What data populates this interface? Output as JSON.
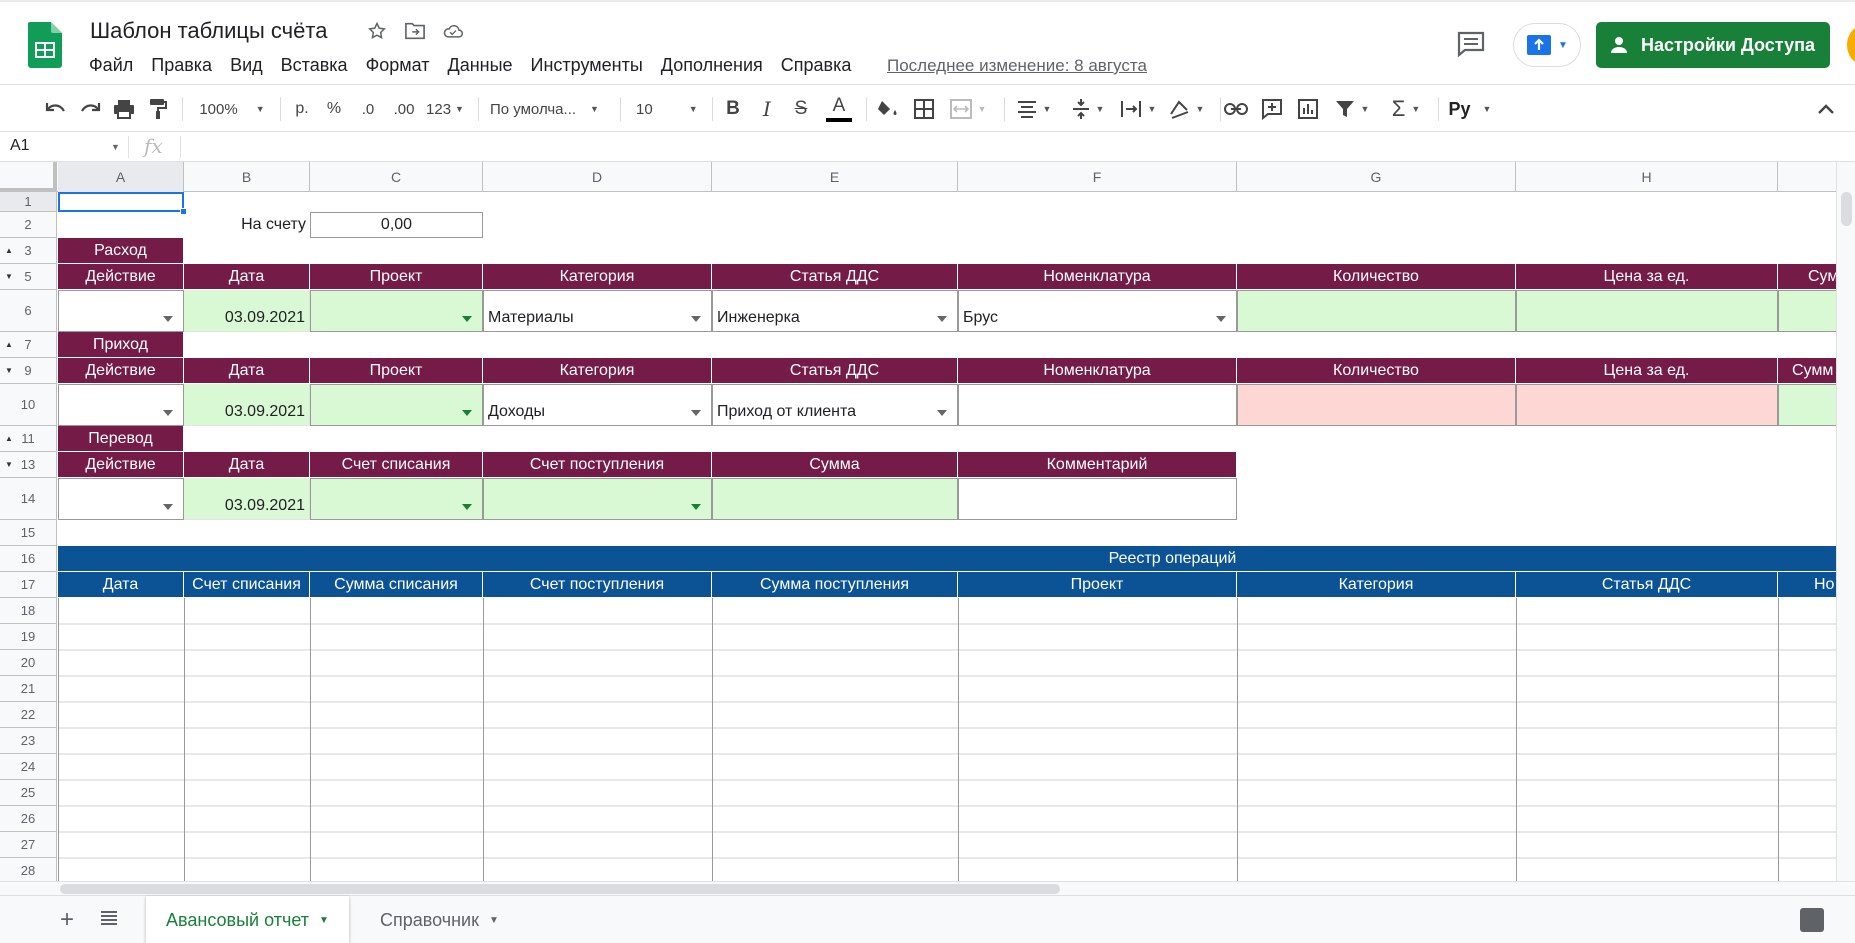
{
  "app": {
    "title": "Шаблон таблицы счёта",
    "menu": [
      "Файл",
      "Правка",
      "Вид",
      "Вставка",
      "Формат",
      "Данные",
      "Инструменты",
      "Дополнения",
      "Справка"
    ],
    "last_edit": "Последнее изменение: 8 августа",
    "share_label": "Настройки Доступа"
  },
  "toolbar": {
    "zoom": "100%",
    "currency": "р.",
    "percent": "%",
    "dec_decrease": ".0",
    "dec_increase": ".00",
    "number_format": "123",
    "font": "По умолча...",
    "font_size": "10",
    "bold": "B",
    "italic": "I",
    "strike": "S",
    "text_color": "A",
    "sigma": "Σ",
    "input_tools": "Py"
  },
  "formula_bar": {
    "cell": "A1",
    "fx": "fx"
  },
  "columns": [
    "A",
    "B",
    "C",
    "D",
    "E",
    "F",
    "G",
    "H",
    ""
  ],
  "rows": [
    "1",
    "2",
    "3",
    "5",
    "6",
    "7",
    "9",
    "10",
    "11",
    "13",
    "14",
    "15",
    "16",
    "17",
    "18",
    "19",
    "20",
    "21",
    "22",
    "23",
    "24",
    "25",
    "26",
    "27",
    "28"
  ],
  "sheet": {
    "balance_label": "На счету",
    "balance_value": "0,00",
    "expense": {
      "title": "Расход",
      "headers": [
        "Действие",
        "Дата",
        "Проект",
        "Категория",
        "Статья ДДС",
        "Номенклатура",
        "Количество",
        "Цена за ед.",
        "Сум"
      ],
      "date": "03.09.2021",
      "category": "Материалы",
      "article": "Инженерка",
      "nomenclature": "Брус"
    },
    "income": {
      "title": "Приход",
      "headers": [
        "Действие",
        "Дата",
        "Проект",
        "Категория",
        "Статья ДДС",
        "Номенклатура",
        "Количество",
        "Цена за ед.",
        "Сумм"
      ],
      "date": "03.09.2021",
      "category": "Доходы",
      "article": "Приход от клиента"
    },
    "transfer": {
      "title": "Перевод",
      "headers": [
        "Действие",
        "Дата",
        "Счет списания",
        "Счет поступления",
        "Сумма",
        "Комментарий"
      ],
      "date": "03.09.2021"
    },
    "registry": {
      "title": "Реестр операций",
      "headers": [
        "Дата",
        "Счет списания",
        "Сумма списания",
        "Счет поступления",
        "Сумма поступления",
        "Проект",
        "Категория",
        "Статья ДДС",
        "Но"
      ]
    }
  },
  "tabs": [
    {
      "label": "Авансовый отчет",
      "active": true
    },
    {
      "label": "Справочник",
      "active": false
    }
  ],
  "colors": {
    "wine": "#741b47",
    "blue": "#0b5394",
    "green": "#d9f9d4",
    "pink": "#fcd7d3",
    "share": "#188038"
  }
}
